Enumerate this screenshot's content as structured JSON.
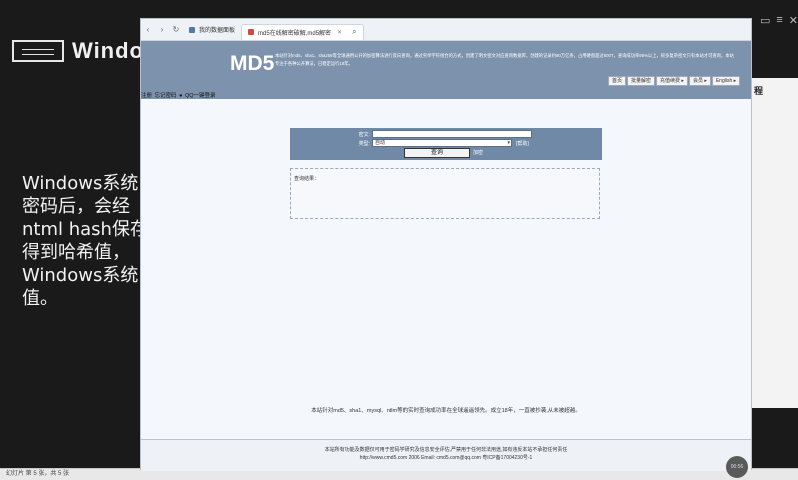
{
  "slide": {
    "logo_text": "Windo",
    "body_lines": [
      "Windows系统",
      "密码后，会经",
      "ntml hash保存",
      "得到哈希值，",
      "Windows系统",
      "值。"
    ],
    "right_panel_text": "程"
  },
  "browser": {
    "tabs": [
      {
        "label": "我的数据面板"
      },
      {
        "label": "md5在线解密破解,md5解密"
      }
    ]
  },
  "md5": {
    "logo": "MD5",
    "description": "本站针对md5、sha1、sha256等全球通用公开的加密算法进行反向查询，通过穷举字符组合的方式，创建了明文密文对应查询数据库，创建的记录约90万亿条，占用硬盘超过500T，查询成功率95%以上，很多复杂密文只有本站才可查询。本站专注于各种公开算法，已稳定运行19年。",
    "nav": [
      "首页",
      "批量解密",
      "充值续费 ▸",
      "会员 ▸",
      "English ▸"
    ],
    "login_strip": [
      "注册",
      "忘记密码",
      "QQ一键登录"
    ],
    "form": {
      "ciphertext_label": "密文:",
      "ciphertext_value": "",
      "type_label": "类型:",
      "type_value": "自动",
      "help_link": "[帮助]",
      "query_button": "查询",
      "encrypt_link": "加密"
    },
    "result_label": "查询结果：",
    "promo": "本站针对md5、sha1、mysql、ntlm等的实时查询成功率在全球遥遥领先。成立18年，一直被抄袭,从未被超越。",
    "footer": [
      "本站所有功能及数据仅可用于密码学研究及信息安全评估,严禁用于任何非法用途,如有违反本站不承担任何责任",
      "http://www.cmd5.com 2006   Email: cmd5.com@qq.com  粤ICP备17004230号-1"
    ]
  },
  "statusbar": {
    "text": "幻灯片 第 5 张，共 5 张"
  },
  "avatar_text": "00:56"
}
